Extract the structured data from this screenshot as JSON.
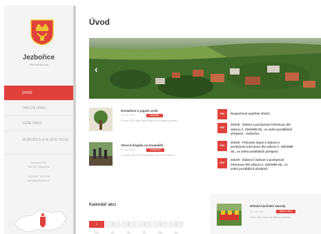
{
  "sidebar": {
    "town_name": "Jezbořice",
    "region": "Pardubický kraj",
    "items": [
      {
        "label": "Úvod",
        "active": true
      },
      {
        "label": "Obecní úřad",
        "active": false
      },
      {
        "label": "Naše obec",
        "active": false
      },
      {
        "label": "Jezbořice a blízké okolí",
        "active": false
      }
    ],
    "contact": {
      "address_1": "Jezbořice 65",
      "address_2": "530 02 Pardubice",
      "phone": "+420 607 024 978",
      "email": "info@jezborice.cz"
    }
  },
  "main": {
    "title": "Úvod",
    "news": [
      {
        "title": "Doslalšení u jugaže areál",
        "date": "26. září 2022",
        "tag": "Aktuálně",
        "excerpt": "V roce 2022 bylo díky dotačním a vlastní prostře..."
      },
      {
        "title": "Obecní brigáda na koupališti",
        "date": "26. září 2022",
        "tag": "Oznámení",
        "excerpt": "V sobotu 28.9.2022 proběhla od 14:00 obecní..."
      }
    ],
    "docs": [
      {
        "text": "Rozpočtové opatření 2/2022"
      },
      {
        "text": "2022/6 - Žádost o poskytnutí informace dle\nzákona č. 106/1999 Sb., ve znění pozdějších\npředpisů - Jezbořice"
      },
      {
        "text": "2022/6 - Průvodní dopis k žádosti o\nposkytnutí informace dle zákona č. 106/1999\nSb., ve znění pozdějších předpisů"
      },
      {
        "text": "2022/6 - Žádost k žádosti o poskytnutí\ninformace dle zákona č. 106/1999 Sb., ve\nznění pozdějších předpisů"
      }
    ],
    "calendar": {
      "title": "Kalendář akcí",
      "days": [
        "1",
        "2",
        "3",
        "4",
        "5",
        "6"
      ],
      "active_index": 0,
      "dow": [
        "Po",
        "Út",
        "St",
        "Čt",
        "Pá",
        "So"
      ]
    },
    "event": {
      "title": "Dětské hasičské závody",
      "date": "26. září 2022",
      "tag": "Akce v obci",
      "excerpt": "Tímto Vás zveme na Dětské hasičské..."
    }
  }
}
